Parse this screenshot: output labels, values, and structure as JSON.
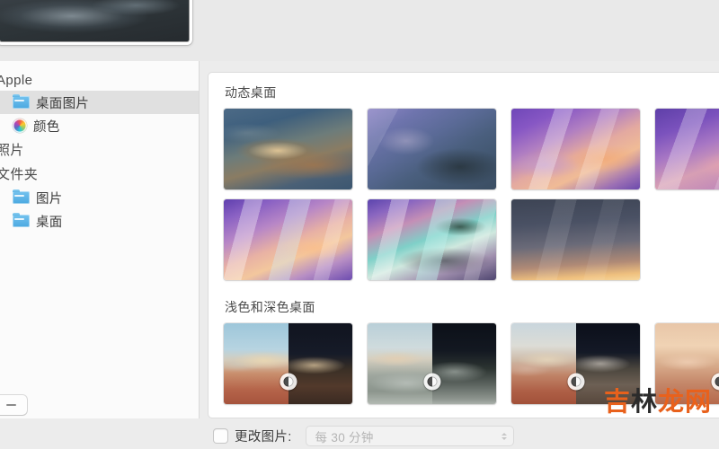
{
  "window": {
    "preview": {
      "icon": "desktop-preview-thumbnail",
      "alt": "dark mountain wallpaper preview"
    }
  },
  "sidebar": {
    "groups": [
      {
        "header": "Apple",
        "items": [
          {
            "label": "桌面图片",
            "icon": "folder-icon",
            "selected": true
          },
          {
            "label": "颜色",
            "icon": "color-wheel-icon",
            "selected": false
          }
        ]
      },
      {
        "header": "照片",
        "items": []
      },
      {
        "header": "文件夹",
        "items": [
          {
            "label": "图片",
            "icon": "folder-icon",
            "selected": false
          },
          {
            "label": "桌面",
            "icon": "folder-icon",
            "selected": false
          }
        ]
      }
    ],
    "remove_button": {
      "label": "−",
      "name": "remove-folder-button"
    }
  },
  "content": {
    "sections": [
      {
        "title": "动态桌面",
        "rows": [
          [
            {
              "name": "wallpaper-catalina",
              "style": "wp-catalina",
              "badge": false
            },
            {
              "name": "wallpaper-big-sur",
              "style": "wp-bigsur",
              "badge": false
            },
            {
              "name": "wallpaper-purple-mountain",
              "style": "wp-purple-mtn",
              "badge": false
            },
            {
              "name": "wallpaper-purple-peak",
              "style": "wp-purple2",
              "badge": false
            }
          ],
          [
            {
              "name": "wallpaper-mountain-dawn",
              "style": "wp-mtn-dawn",
              "badge": false
            },
            {
              "name": "wallpaper-coastline",
              "style": "wp-coast",
              "badge": false
            },
            {
              "name": "wallpaper-dusk-gradient",
              "style": "wp-dusk",
              "badge": false
            }
          ]
        ]
      },
      {
        "title": "浅色和深色桌面",
        "rows": [
          [
            {
              "name": "wallpaper-solar-gradient-1",
              "split": [
                "lt-a",
                "dk-a"
              ],
              "badge": true
            },
            {
              "name": "wallpaper-solar-gradient-2",
              "split": [
                "lt-b",
                "dk-b"
              ],
              "badge": true
            },
            {
              "name": "wallpaper-solar-gradient-3",
              "split": [
                "lt-c",
                "dk-c"
              ],
              "badge": true
            },
            {
              "name": "wallpaper-solar-gradient-4",
              "split": [
                "lt-d",
                "dk-d"
              ],
              "badge": true
            }
          ]
        ]
      }
    ]
  },
  "bottom": {
    "change_picture_label": "更改图片:",
    "change_picture_checked": false,
    "interval_value": "每 30 分钟"
  },
  "watermark": {
    "part1": "吉",
    "part2": "林",
    "part3": "龙网"
  },
  "colors": {
    "accent": "#4aa8e0",
    "watermark_orange": "#e8611c",
    "watermark_dark": "#2b2b2b",
    "sidebar_bg": "#fbfbfb",
    "selection": "#e0e0e0"
  }
}
